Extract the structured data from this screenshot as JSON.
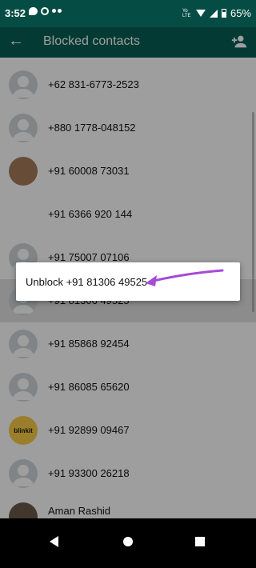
{
  "status": {
    "time": "3:52",
    "lte": "Yo LTE",
    "battery": "65%"
  },
  "appbar": {
    "title": "Blocked contacts",
    "back_icon": "arrow-left-icon",
    "add_icon": "add-contact-icon"
  },
  "contacts": [
    {
      "number": "+62 831-6773-2523",
      "avatar": "default"
    },
    {
      "number": "+880 1778-048152",
      "avatar": "default"
    },
    {
      "number": "+91 60008 73031",
      "avatar": "photo"
    },
    {
      "number": "+91 6366 920 144",
      "avatar": "logo"
    },
    {
      "number": "+91 75007 07106",
      "avatar": "default"
    },
    {
      "number": "+91 81306 49525",
      "avatar": "default"
    },
    {
      "number": "+91 85868 92454",
      "avatar": "default"
    },
    {
      "number": "+91 86085 65620",
      "avatar": "default"
    },
    {
      "number": "+91 92899 09467",
      "avatar": "blinkit",
      "avatar_text": "blinkit"
    },
    {
      "number": "+91 93300 26218",
      "avatar": "default"
    },
    {
      "name": "Aman Rashid",
      "avatar": "photo2"
    }
  ],
  "dialog": {
    "option": "Unblock +91 81306 49525"
  },
  "colors": {
    "header": "#075e54",
    "status": "#054d44",
    "annotation": "#a64ad8"
  }
}
